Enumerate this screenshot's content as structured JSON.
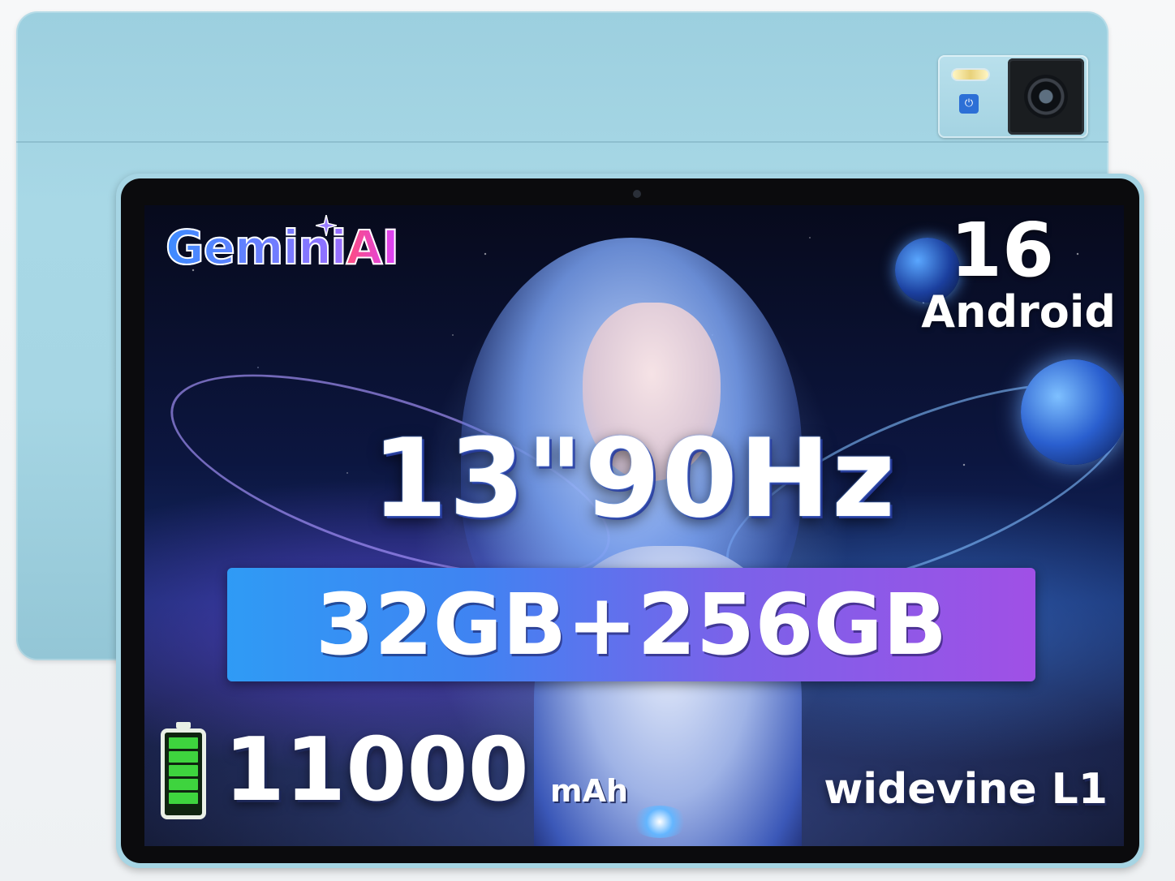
{
  "product": {
    "ai_brand": {
      "part_blue": "Gemini",
      "part_red": "AI"
    },
    "android_version": "16",
    "android_label": "Android",
    "headline": "13\"90Hz",
    "memory": "32GB+256GB",
    "battery_value": "11000",
    "battery_unit": "mAh",
    "drm": "widevine L1"
  },
  "colors": {
    "tablet_body": "#a6d5e4",
    "banner_start": "#2f9bf5",
    "banner_end": "#a050e6",
    "battery_green": "#3ed43e"
  },
  "icons": {
    "battery": "battery-full-icon",
    "sparkle": "sparkle-icon",
    "sensor": "power-sensor-icon"
  }
}
